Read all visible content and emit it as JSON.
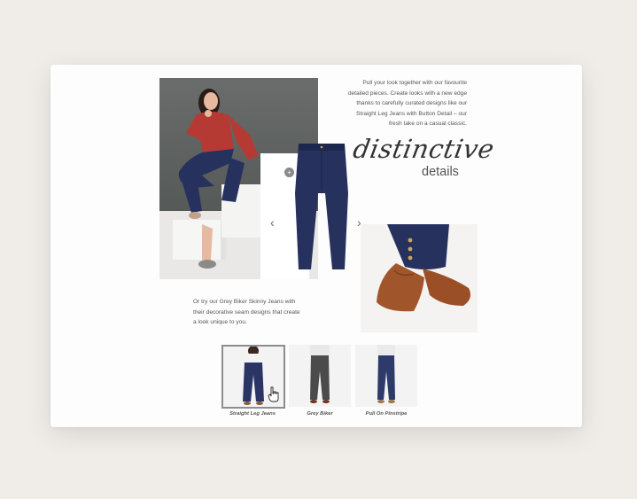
{
  "intro": {
    "paragraph": "Pull your look together with our favourite detailed pieces. Create looks with a new edge thanks to carefully curated designs like our Straight Leg Jeans with Button Detail – our fresh take on a casual classic.",
    "lines": [
      "Pull your look together with our favourite",
      "detailed pieces. Create looks with a new edge",
      "thanks to carefully curated designs like our",
      "Straight Leg Jeans with Button Detail – our",
      "fresh take on a casual classic."
    ]
  },
  "heading": {
    "script": "distinctive",
    "sub": "details"
  },
  "secondary": {
    "lines": [
      "Or try our Grey Biker Skinny Jeans with",
      "their decorative seam designs that create",
      "a look unique to you."
    ]
  },
  "carousel": {
    "prev_icon": "chevron-left-icon",
    "next_icon": "chevron-right-icon",
    "prev": "‹",
    "next": "›",
    "hotspot": "+"
  },
  "thumbnails": [
    {
      "label": "Straight Leg Jeans",
      "color": "#2a3566",
      "selected": true
    },
    {
      "label": "Grey Biker",
      "color": "#4b4b4b",
      "selected": false
    },
    {
      "label": "Pull On Pinstripe",
      "color": "#2d3a6a",
      "selected": false
    }
  ],
  "colors": {
    "denim": "#26315e",
    "top": "#b53a33",
    "shoe": "#a0552a",
    "background": "#f0ece8"
  }
}
